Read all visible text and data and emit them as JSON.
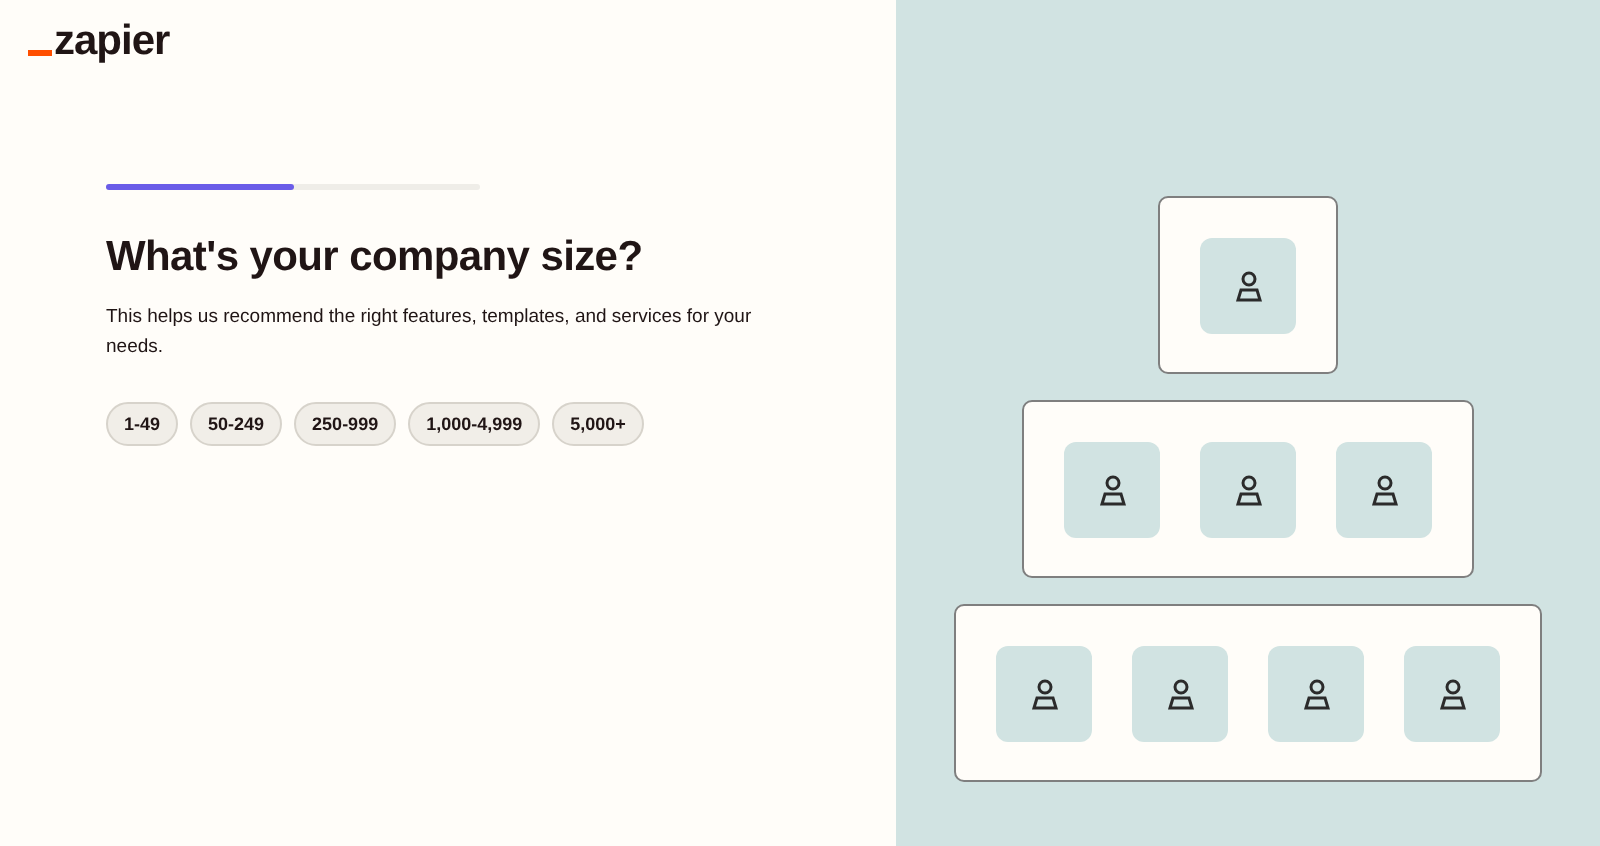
{
  "logo": {
    "text": "zapier"
  },
  "progress": {
    "level": 0.5
  },
  "heading": "What's your company size?",
  "description": "This helps us recommend the right features, templates, and services for your needs.",
  "options": [
    {
      "label": "1-49",
      "selected": false
    },
    {
      "label": "50-249",
      "selected": false
    },
    {
      "label": "250-999",
      "selected": false
    },
    {
      "label": "1,000-4,999",
      "selected": false
    },
    {
      "label": "5,000+",
      "selected": false
    }
  ]
}
